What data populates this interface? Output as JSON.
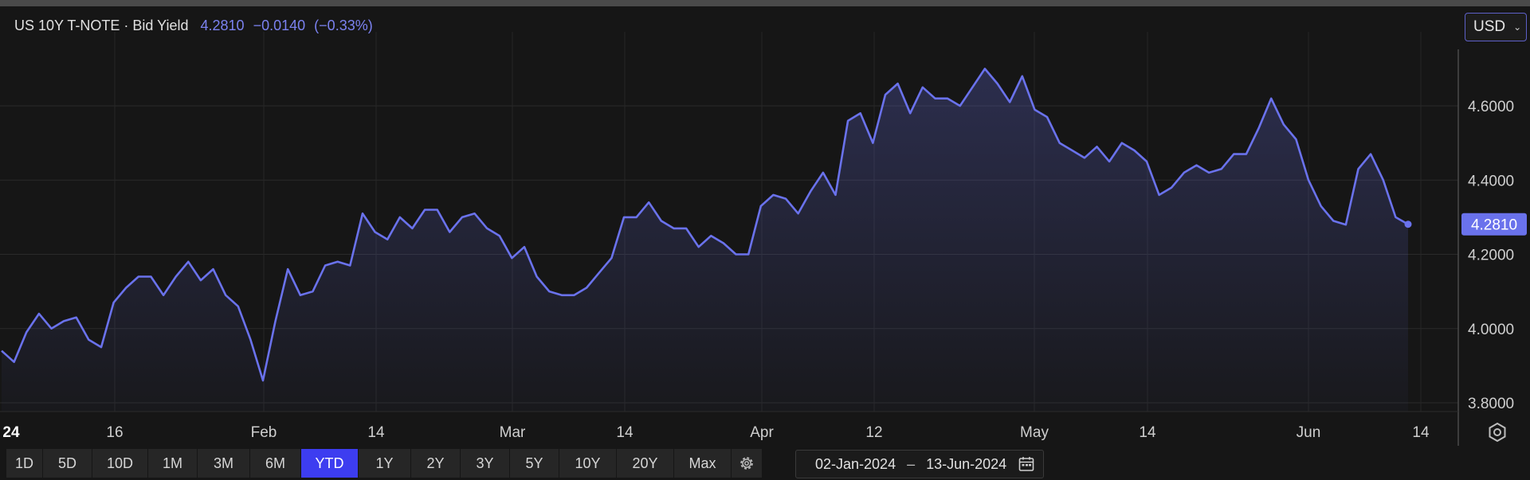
{
  "header": {
    "instrument": "US 10Y T-NOTE",
    "separator": "·",
    "field": "Bid Yield",
    "last": "4.2810",
    "change": "−0.0140",
    "change_pct": "(−0.33%)"
  },
  "currency": {
    "selected": "USD"
  },
  "toolbar": {
    "timeframes": [
      "1D",
      "5D",
      "10D",
      "1M",
      "3M",
      "6M",
      "YTD",
      "1Y",
      "2Y",
      "3Y",
      "5Y",
      "10Y",
      "20Y",
      "Max"
    ],
    "active": "YTD"
  },
  "date_range": {
    "start": "02-Jan-2024",
    "separator": "–",
    "end": "13-Jun-2024"
  },
  "colors": {
    "line": "#6a72ec",
    "active_button": "#3d3df0",
    "last_price_label": "#6a72ec",
    "background": "#161616"
  },
  "icons": [
    "gear-icon",
    "calendar-icon",
    "chart-settings-icon",
    "chevron-down-icon"
  ],
  "chart_data": {
    "type": "area",
    "title": "",
    "xlabel": "",
    "ylabel": "",
    "x_tick_labels": [
      "24",
      "16",
      "Feb",
      "14",
      "Mar",
      "14",
      "Apr",
      "12",
      "May",
      "14",
      "Jun",
      "14"
    ],
    "y_ticks": [
      "3.8000",
      "4.0000",
      "4.2000",
      "4.4000",
      "4.6000"
    ],
    "ylim": [
      3.8,
      4.75
    ],
    "last_value_label": "4.2810",
    "grid": true,
    "legend": "none",
    "series": [
      {
        "values": [
          3.94,
          3.91,
          3.99,
          4.04,
          4.0,
          4.02,
          4.03,
          3.97,
          3.95,
          4.07,
          4.11,
          4.14,
          4.14,
          4.09,
          4.14,
          4.18,
          4.13,
          4.16,
          4.09,
          4.06,
          3.97,
          3.86,
          4.02,
          4.16,
          4.09,
          4.1,
          4.17,
          4.18,
          4.17,
          4.31,
          4.26,
          4.24,
          4.3,
          4.27,
          4.32,
          4.32,
          4.26,
          4.3,
          4.31,
          4.27,
          4.25,
          4.19,
          4.22,
          4.14,
          4.1,
          4.09,
          4.09,
          4.11,
          4.15,
          4.19,
          4.3,
          4.3,
          4.34,
          4.29,
          4.27,
          4.27,
          4.22,
          4.25,
          4.23,
          4.2,
          4.2,
          4.33,
          4.36,
          4.35,
          4.31,
          4.37,
          4.42,
          4.36,
          4.56,
          4.58,
          4.5,
          4.63,
          4.66,
          4.58,
          4.65,
          4.62,
          4.62,
          4.6,
          4.65,
          4.7,
          4.66,
          4.61,
          4.68,
          4.59,
          4.57,
          4.5,
          4.48,
          4.46,
          4.49,
          4.45,
          4.5,
          4.48,
          4.45,
          4.36,
          4.38,
          4.42,
          4.44,
          4.42,
          4.43,
          4.47,
          4.47,
          4.54,
          4.62,
          4.55,
          4.51,
          4.4,
          4.33,
          4.29,
          4.28,
          4.43,
          4.47,
          4.4,
          4.3,
          4.281
        ]
      }
    ]
  }
}
